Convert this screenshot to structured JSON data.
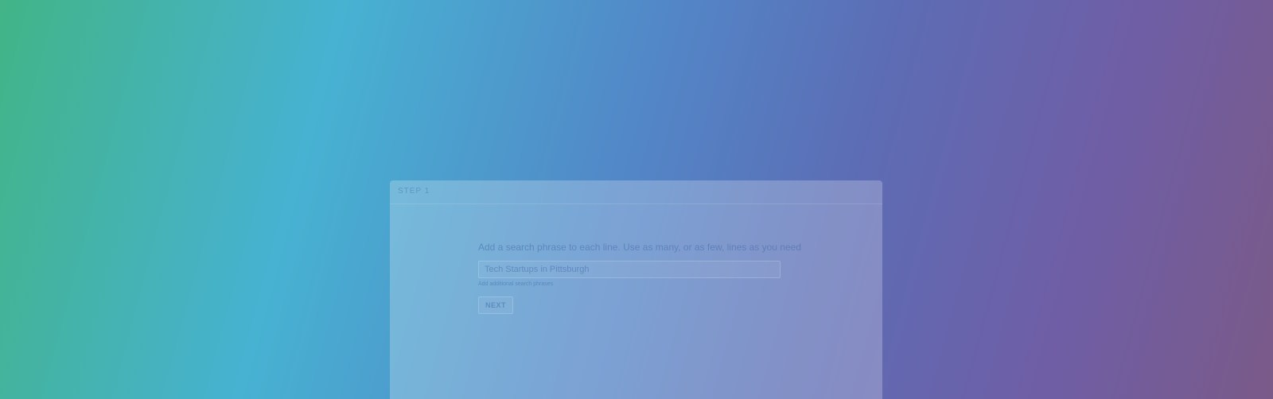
{
  "card": {
    "header_label": "STEP 1",
    "prompt": "Add a search phrase to each line. Use as many, or as few, lines as you need",
    "search_input": {
      "placeholder": "Tech Startups in Pittsburgh",
      "value": ""
    },
    "add_link_label": "Add additional search phrases",
    "next_label": "NEXT"
  },
  "colors": {
    "background_start": "#42b487",
    "background_mid": "#5288c8",
    "background_end": "#7a5a88"
  }
}
